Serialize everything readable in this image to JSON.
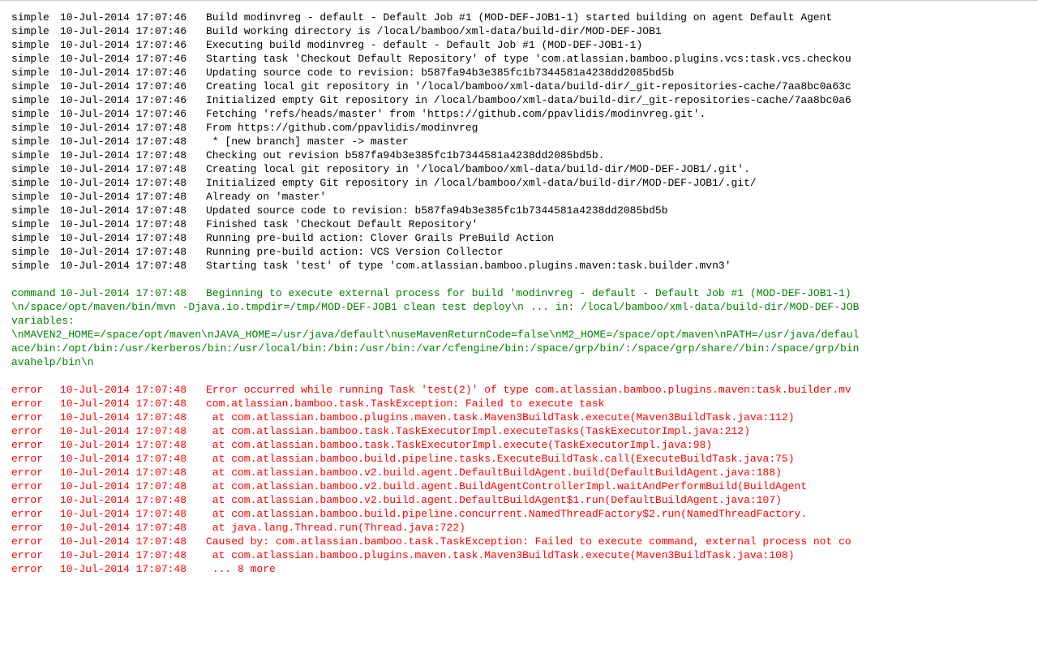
{
  "log": {
    "entries": [
      {
        "level": "simple",
        "timestamp": "10-Jul-2014 17:07:46",
        "message": "Build modinvreg - default - Default Job #1 (MOD-DEF-JOB1-1) started building on agent Default Agent"
      },
      {
        "level": "simple",
        "timestamp": "10-Jul-2014 17:07:46",
        "message": "Build working directory is /local/bamboo/xml-data/build-dir/MOD-DEF-JOB1"
      },
      {
        "level": "simple",
        "timestamp": "10-Jul-2014 17:07:46",
        "message": "Executing build modinvreg - default - Default Job #1 (MOD-DEF-JOB1-1)"
      },
      {
        "level": "simple",
        "timestamp": "10-Jul-2014 17:07:46",
        "message": "Starting task 'Checkout Default Repository' of type 'com.atlassian.bamboo.plugins.vcs:task.vcs.checkou"
      },
      {
        "level": "simple",
        "timestamp": "10-Jul-2014 17:07:46",
        "message": "Updating source code to revision: b587fa94b3e385fc1b7344581a4238dd2085bd5b"
      },
      {
        "level": "simple",
        "timestamp": "10-Jul-2014 17:07:46",
        "message": "Creating local git repository in '/local/bamboo/xml-data/build-dir/_git-repositories-cache/7aa8bc0a63c"
      },
      {
        "level": "simple",
        "timestamp": "10-Jul-2014 17:07:46",
        "message": "Initialized empty Git repository in /local/bamboo/xml-data/build-dir/_git-repositories-cache/7aa8bc0a6"
      },
      {
        "level": "simple",
        "timestamp": "10-Jul-2014 17:07:46",
        "message": "Fetching 'refs/heads/master' from 'https://github.com/ppavlidis/modinvreg.git'."
      },
      {
        "level": "simple",
        "timestamp": "10-Jul-2014 17:07:48",
        "message": "From https://github.com/ppavlidis/modinvreg"
      },
      {
        "level": "simple",
        "timestamp": "10-Jul-2014 17:07:48",
        "message": " * [new branch]      master     -> master"
      },
      {
        "level": "simple",
        "timestamp": "10-Jul-2014 17:07:48",
        "message": "Checking out revision b587fa94b3e385fc1b7344581a4238dd2085bd5b."
      },
      {
        "level": "simple",
        "timestamp": "10-Jul-2014 17:07:48",
        "message": "Creating local git repository in '/local/bamboo/xml-data/build-dir/MOD-DEF-JOB1/.git'."
      },
      {
        "level": "simple",
        "timestamp": "10-Jul-2014 17:07:48",
        "message": "Initialized empty Git repository in /local/bamboo/xml-data/build-dir/MOD-DEF-JOB1/.git/"
      },
      {
        "level": "simple",
        "timestamp": "10-Jul-2014 17:07:48",
        "message": "Already on 'master'"
      },
      {
        "level": "simple",
        "timestamp": "10-Jul-2014 17:07:48",
        "message": "Updated source code to revision: b587fa94b3e385fc1b7344581a4238dd2085bd5b"
      },
      {
        "level": "simple",
        "timestamp": "10-Jul-2014 17:07:48",
        "message": "Finished task 'Checkout Default Repository'"
      },
      {
        "level": "simple",
        "timestamp": "10-Jul-2014 17:07:48",
        "message": "Running pre-build action: Clover Grails PreBuild Action"
      },
      {
        "level": "simple",
        "timestamp": "10-Jul-2014 17:07:48",
        "message": "Running pre-build action: VCS Version Collector"
      },
      {
        "level": "simple",
        "timestamp": "10-Jul-2014 17:07:48",
        "message": "Starting task 'test' of type 'com.atlassian.bamboo.plugins.maven:task.builder.mvn3'"
      },
      {
        "level": "spacer"
      },
      {
        "level": "command",
        "timestamp": "10-Jul-2014 17:07:48",
        "message": "Beginning to execute external process for build 'modinvreg - default - Default Job #1 (MOD-DEF-JOB1-1)"
      },
      {
        "level": "command-cont",
        "message": "\\n/space/opt/maven/bin/mvn -Djava.io.tmpdir=/tmp/MOD-DEF-JOB1 clean test deploy\\n ... in: /local/bamboo/xml-data/build-dir/MOD-DEF-JOB"
      },
      {
        "level": "command-cont",
        "message": "variables:"
      },
      {
        "level": "command-cont",
        "message": "\\nMAVEN2_HOME=/space/opt/maven\\nJAVA_HOME=/usr/java/default\\nuseMavenReturnCode=false\\nM2_HOME=/space/opt/maven\\nPATH=/usr/java/defaul"
      },
      {
        "level": "command-cont",
        "message": "ace/bin:/opt/bin:/usr/kerberos/bin:/usr/local/bin:/bin:/usr/bin:/var/cfengine/bin:/space/grp/bin/:/space/grp/share//bin:/space/grp/bin"
      },
      {
        "level": "command-cont",
        "message": "avahelp/bin\\n"
      },
      {
        "level": "spacer"
      },
      {
        "level": "error",
        "timestamp": "10-Jul-2014 17:07:48",
        "message": "Error occurred while running Task 'test(2)' of type com.atlassian.bamboo.plugins.maven:task.builder.mv"
      },
      {
        "level": "error",
        "timestamp": "10-Jul-2014 17:07:48",
        "message": "com.atlassian.bamboo.task.TaskException: Failed to execute task"
      },
      {
        "level": "error",
        "timestamp": "10-Jul-2014 17:07:48",
        "message": "        at com.atlassian.bamboo.plugins.maven.task.Maven3BuildTask.execute(Maven3BuildTask.java:112)"
      },
      {
        "level": "error",
        "timestamp": "10-Jul-2014 17:07:48",
        "message": "        at com.atlassian.bamboo.task.TaskExecutorImpl.executeTasks(TaskExecutorImpl.java:212)"
      },
      {
        "level": "error",
        "timestamp": "10-Jul-2014 17:07:48",
        "message": "        at com.atlassian.bamboo.task.TaskExecutorImpl.execute(TaskExecutorImpl.java:98)"
      },
      {
        "level": "error",
        "timestamp": "10-Jul-2014 17:07:48",
        "message": "        at com.atlassian.bamboo.build.pipeline.tasks.ExecuteBuildTask.call(ExecuteBuildTask.java:75)"
      },
      {
        "level": "error",
        "timestamp": "10-Jul-2014 17:07:48",
        "message": "        at com.atlassian.bamboo.v2.build.agent.DefaultBuildAgent.build(DefaultBuildAgent.java:188)"
      },
      {
        "level": "error",
        "timestamp": "10-Jul-2014 17:07:48",
        "message": "        at com.atlassian.bamboo.v2.build.agent.BuildAgentControllerImpl.waitAndPerformBuild(BuildAgent"
      },
      {
        "level": "error",
        "timestamp": "10-Jul-2014 17:07:48",
        "message": "        at com.atlassian.bamboo.v2.build.agent.DefaultBuildAgent$1.run(DefaultBuildAgent.java:107)"
      },
      {
        "level": "error",
        "timestamp": "10-Jul-2014 17:07:48",
        "message": "        at com.atlassian.bamboo.build.pipeline.concurrent.NamedThreadFactory$2.run(NamedThreadFactory."
      },
      {
        "level": "error",
        "timestamp": "10-Jul-2014 17:07:48",
        "message": "        at java.lang.Thread.run(Thread.java:722)"
      },
      {
        "level": "error",
        "timestamp": "10-Jul-2014 17:07:48",
        "message": "Caused by: com.atlassian.bamboo.task.TaskException: Failed to execute command, external process not co"
      },
      {
        "level": "error",
        "timestamp": "10-Jul-2014 17:07:48",
        "message": "        at com.atlassian.bamboo.plugins.maven.task.Maven3BuildTask.execute(Maven3BuildTask.java:108)"
      },
      {
        "level": "error",
        "timestamp": "10-Jul-2014 17:07:48",
        "message": "        ... 8 more"
      }
    ]
  }
}
